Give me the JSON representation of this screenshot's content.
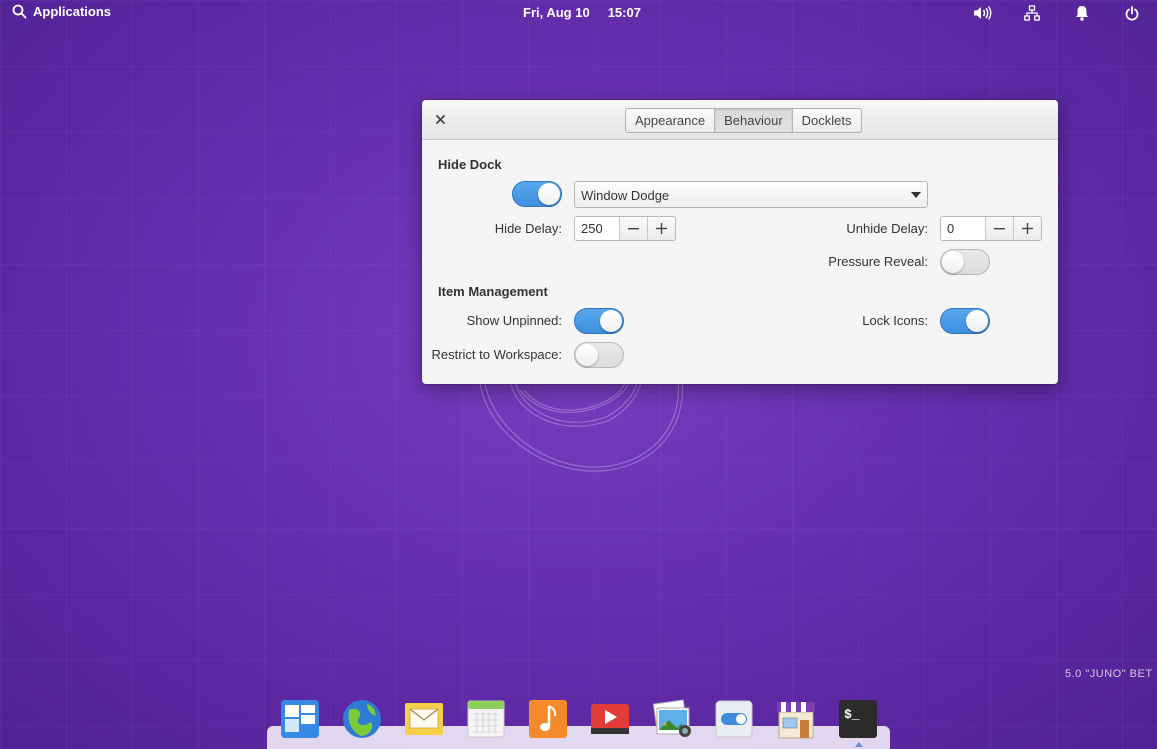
{
  "panel": {
    "applications_label": "Applications",
    "date": "Fri, Aug 10",
    "time": "15:07",
    "indicators": [
      "volume-icon",
      "network-icon",
      "notifications-icon",
      "power-icon"
    ]
  },
  "dialog": {
    "tabs": [
      {
        "label": "Appearance",
        "active": false
      },
      {
        "label": "Behaviour",
        "active": true
      },
      {
        "label": "Docklets",
        "active": false
      }
    ],
    "hide_dock": {
      "section_title": "Hide Dock",
      "enabled": true,
      "mode": "Window Dodge",
      "hide_delay_label": "Hide Delay:",
      "hide_delay_value": "250",
      "unhide_delay_label": "Unhide Delay:",
      "unhide_delay_value": "0",
      "pressure_reveal_label": "Pressure Reveal:",
      "pressure_reveal": false
    },
    "item_management": {
      "section_title": "Item Management",
      "show_unpinned_label": "Show Unpinned:",
      "show_unpinned": true,
      "lock_icons_label": "Lock Icons:",
      "lock_icons": true,
      "restrict_label": "Restrict to Workspace:",
      "restrict": false
    }
  },
  "desktop": {
    "version_text": "5.0 \"JUNO\" BET"
  },
  "dock": {
    "items": [
      "multitasking-view-icon",
      "web-browser-icon",
      "mail-icon",
      "calendar-icon",
      "music-icon",
      "videos-icon",
      "photos-icon",
      "settings-icon",
      "appcenter-icon",
      "terminal-icon"
    ],
    "accent": "#3d8fdd"
  }
}
